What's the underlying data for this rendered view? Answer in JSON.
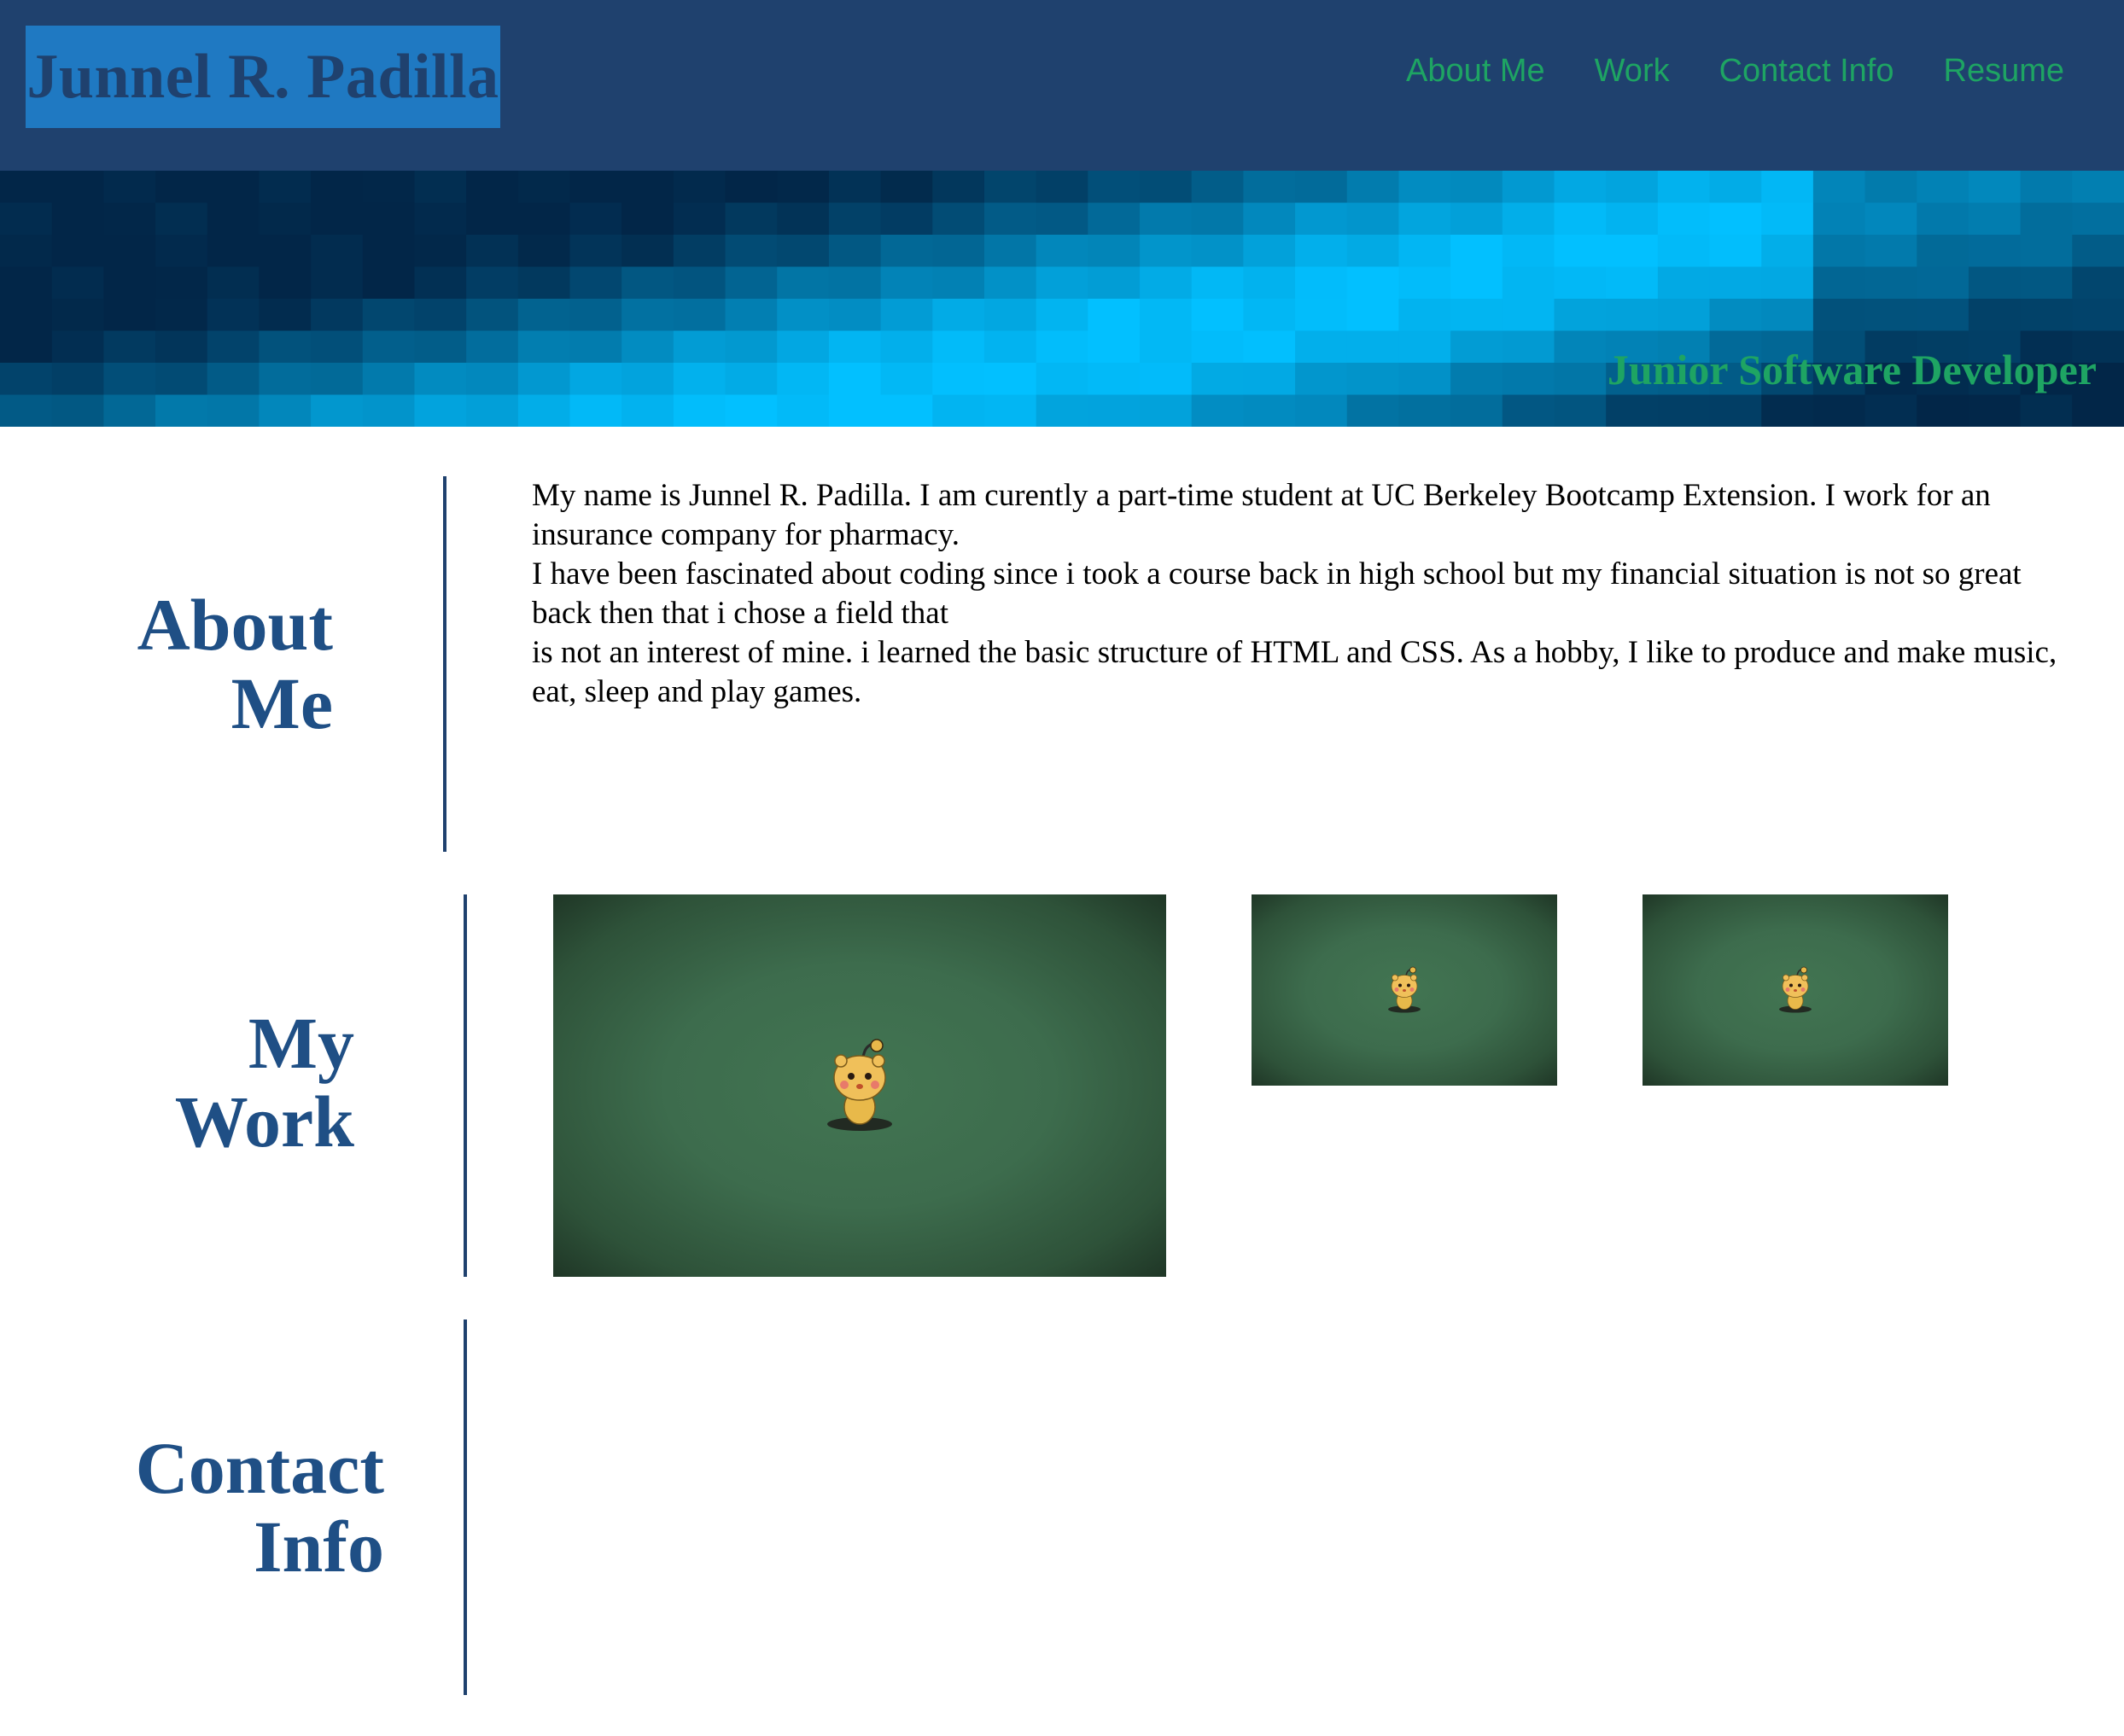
{
  "header": {
    "brand": "Junnel R. Padilla",
    "nav": [
      "About Me",
      "Work",
      "Contact Info",
      "Resume"
    ]
  },
  "hero": {
    "subtitle": "Junior Software Developer"
  },
  "about": {
    "title_line1": "About",
    "title_line2": "Me",
    "paragraph1": "My name is Junnel R. Padilla. I am curently a part-time student at UC Berkeley Bootcamp Extension. I work for an insurance company for pharmacy.",
    "paragraph2": "I have been fascinated about coding since i took a course back in high school but my financial situation is not so great back then that i chose a field that",
    "paragraph3": "is not an interest of mine. i learned the basic structure of HTML and CSS. As a hobby, I like to produce and make music, eat, sleep and play games."
  },
  "work": {
    "title_line1": "My",
    "title_line2": "Work",
    "projects": [
      {
        "image": "mascot-icon"
      },
      {
        "image": "mascot-icon"
      },
      {
        "image": "mascot-icon"
      }
    ]
  },
  "contact": {
    "title_line1": "Contact",
    "title_line2": "Info"
  },
  "colors": {
    "header_bg": "#1f416e",
    "brand_bg": "#1f79c2",
    "accent_green": "#1ea463",
    "heading_blue": "#1f4f85",
    "thumb_green": "#3d6c4d"
  }
}
